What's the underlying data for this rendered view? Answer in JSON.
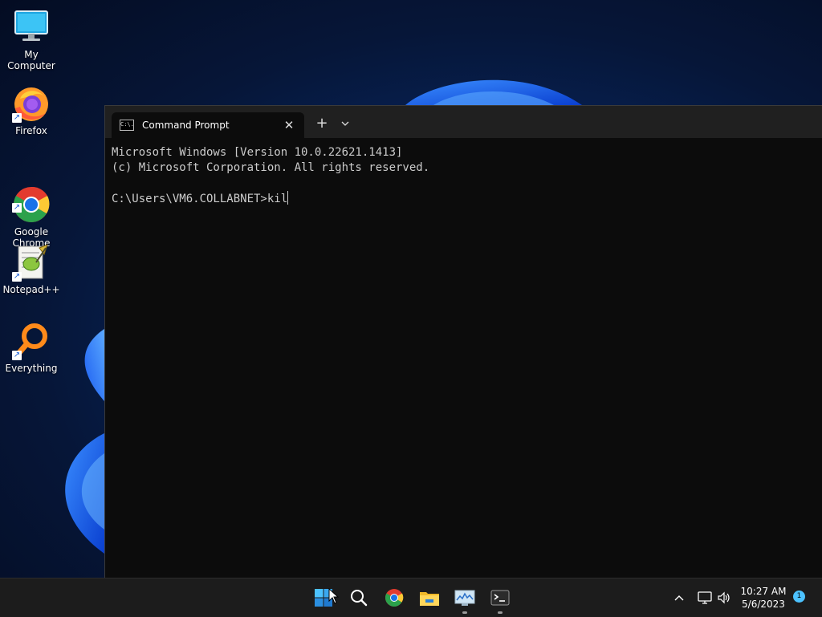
{
  "desktop": {
    "icons": [
      {
        "label": "My Computer",
        "icon": "computer-icon"
      },
      {
        "label": "Firefox",
        "icon": "firefox-icon"
      },
      {
        "label": "Google\nChrome",
        "icon": "chrome-icon"
      },
      {
        "label": "Notepad++",
        "icon": "notepadpp-icon"
      },
      {
        "label": "Everything",
        "icon": "everything-icon"
      }
    ]
  },
  "terminal": {
    "tab_title": "Command Prompt",
    "tab_icon_text": "C:\\.",
    "close_glyph": "✕",
    "new_tab_glyph": "+",
    "lines": [
      "Microsoft Windows [Version 10.0.22621.1413]",
      "(c) Microsoft Corporation. All rights reserved.",
      ""
    ],
    "prompt": "C:\\Users\\VM6.COLLABNET>",
    "typed_input": "kil"
  },
  "taskbar": {
    "apps": [
      {
        "name": "start",
        "icon": "windows-logo-icon",
        "running": false
      },
      {
        "name": "search",
        "icon": "search-icon",
        "running": false
      },
      {
        "name": "chrome",
        "icon": "chrome-icon",
        "running": false
      },
      {
        "name": "file-explorer",
        "icon": "folder-icon",
        "running": false
      },
      {
        "name": "resource-monitor",
        "icon": "monitor-chart-icon",
        "running": true
      },
      {
        "name": "terminal",
        "icon": "terminal-icon",
        "running": true
      }
    ],
    "time": "10:27 AM",
    "date": "5/6/2023",
    "notification_count": "1"
  },
  "colors": {
    "accent": "#4cc2ff",
    "terminal_bg": "#0c0c0c",
    "tabbar_bg": "#202020",
    "taskbar_bg": "#1c1c1c"
  }
}
